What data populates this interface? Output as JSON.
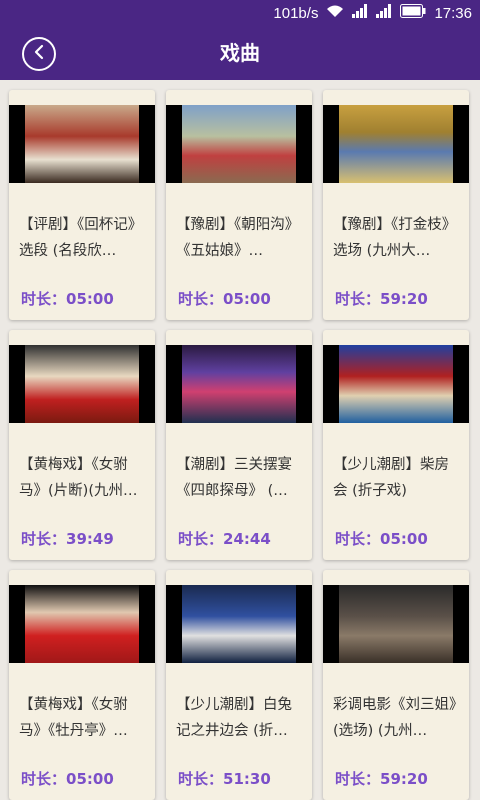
{
  "status_bar": {
    "speed": "101b/s",
    "time": "17:36"
  },
  "header": {
    "title": "戏曲"
  },
  "colors": {
    "primary": "#4a2684",
    "card_bg": "#f5f0e2",
    "duration": "#7b4fc8"
  },
  "videos": [
    {
      "title": "【评剧】《回杯记》选段 (名段欣…",
      "duration_label": "时长：",
      "duration": "05:00"
    },
    {
      "title": "【豫剧】《朝阳沟》《五姑娘》…",
      "duration_label": "时长：",
      "duration": "05:00"
    },
    {
      "title": "【豫剧】《打金枝》选场 (九州大…",
      "duration_label": "时长：",
      "duration": "59:20"
    },
    {
      "title": "【黄梅戏】《女驸马》(片断)(九州…",
      "duration_label": "时长：",
      "duration": "39:49"
    },
    {
      "title": "【潮剧】三关摆宴《四郎探母》 (…",
      "duration_label": "时长：",
      "duration": "24:44"
    },
    {
      "title": "【少儿潮剧】柴房会 (折子戏)",
      "duration_label": "时长：",
      "duration": "05:00"
    },
    {
      "title": "【黄梅戏】《女驸马》《牡丹亭》…",
      "duration_label": "时长：",
      "duration": "05:00"
    },
    {
      "title": "【少儿潮剧】白兔记之井边会 (折…",
      "duration_label": "时长：",
      "duration": "51:30"
    },
    {
      "title": "彩调电影《刘三姐》(选场) (九州…",
      "duration_label": "时长：",
      "duration": "59:20"
    }
  ]
}
